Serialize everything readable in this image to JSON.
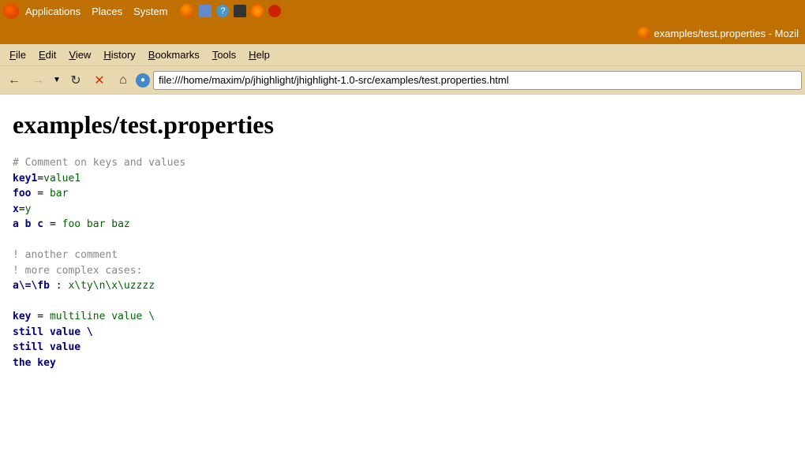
{
  "system_bar": {
    "app_menu": "Applications",
    "places": "Places",
    "system": "System"
  },
  "title_bar": {
    "title": "examples/test.properties - Mozil"
  },
  "menu_bar": {
    "items": [
      {
        "label": "File",
        "underline": "F"
      },
      {
        "label": "Edit",
        "underline": "E"
      },
      {
        "label": "View",
        "underline": "V"
      },
      {
        "label": "History",
        "underline": "H"
      },
      {
        "label": "Bookmarks",
        "underline": "B"
      },
      {
        "label": "Tools",
        "underline": "T"
      },
      {
        "label": "Help",
        "underline": "H"
      }
    ]
  },
  "nav_bar": {
    "address": "file:///home/maxim/p/jhighlight/jhighlight-1.0-src/examples/test.properties.html"
  },
  "page": {
    "title": "examples/test.properties",
    "code_lines": [
      {
        "type": "comment",
        "text": "# Comment on keys and values"
      },
      {
        "type": "keyvalue",
        "key": "key1",
        "sep": "=",
        "value": "value1"
      },
      {
        "type": "keyvalue",
        "key": "foo",
        "sep": " = ",
        "value": "bar"
      },
      {
        "type": "keyvalue",
        "key": "x",
        "sep": "=",
        "value": "y"
      },
      {
        "type": "keyvalue",
        "key": "a b c",
        "sep": " = ",
        "value": "foo bar baz"
      },
      {
        "type": "blank"
      },
      {
        "type": "comment",
        "text": "! another comment"
      },
      {
        "type": "comment",
        "text": "! more complex cases:"
      },
      {
        "type": "keyvalue",
        "key": "a\\=\\fb",
        "sep": " : ",
        "value": "x\\ty\\n\\x\\uzzzz"
      },
      {
        "type": "blank"
      },
      {
        "type": "keyvalue_multiline",
        "key": " key",
        "sep": " = ",
        "value": "multiline value \\"
      },
      {
        "type": "continuation",
        "text": "still value \\"
      },
      {
        "type": "continuation",
        "text": "still value"
      },
      {
        "type": "key_only",
        "text": "the key"
      }
    ]
  }
}
